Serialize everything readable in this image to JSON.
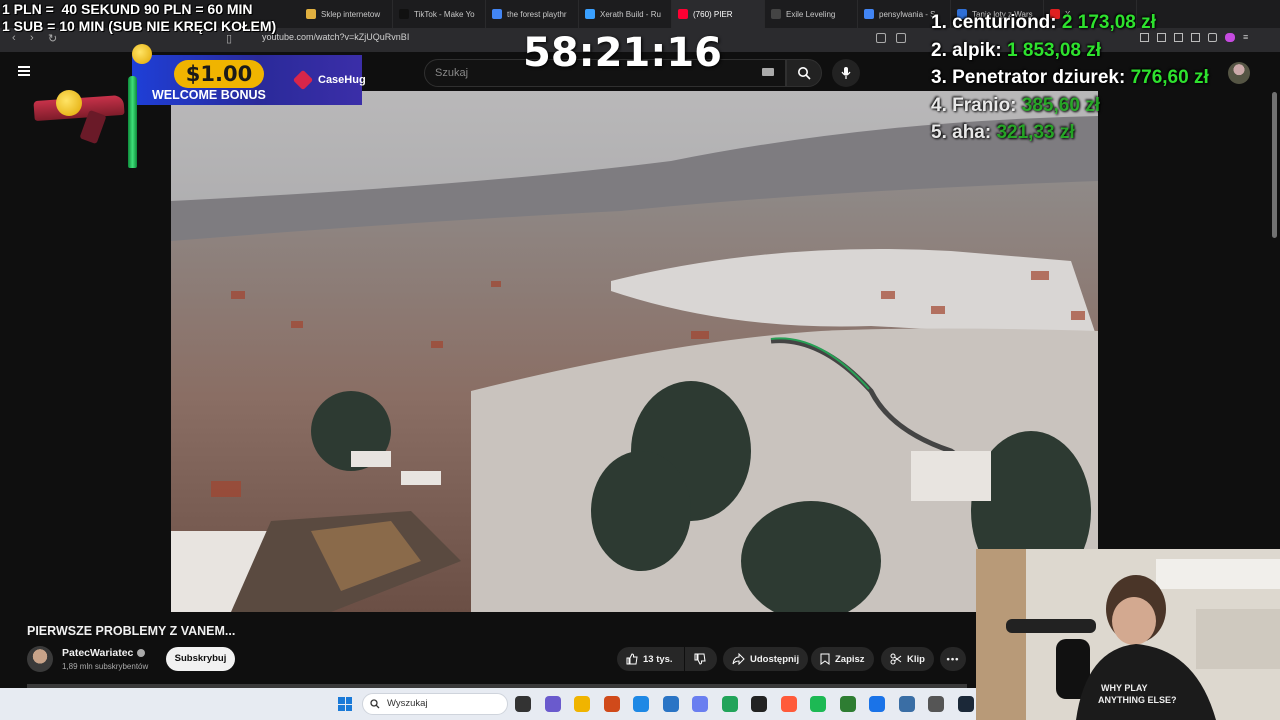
{
  "overlay": {
    "rules_line1": "1 PLN =  40 SEKUND 90 PLN = 60 MIN",
    "rules_line2": "1 SUB = 10 MIN (SUB NIE KRĘCI KOŁEM)",
    "timer": "58:21:16",
    "leaderboard": [
      {
        "label": "1. centuriond:",
        "amount": "2 173,08 zł"
      },
      {
        "label": "2. alpik:",
        "amount": "1 853,08 zł"
      },
      {
        "label": "3. Penetrator dziurek:",
        "amount": "776,60 zł"
      },
      {
        "label": "4. Franio:",
        "amount": "385,60 zł"
      },
      {
        "label": "5. aha:",
        "amount": "321,33 zł"
      }
    ],
    "bonus": {
      "amount": "$1.00",
      "text": "WELCOME BONUS",
      "brand": "CaseHug"
    }
  },
  "browser": {
    "tabs": [
      {
        "label": "Sklep internetow",
        "color": "#e0b040"
      },
      {
        "label": "TikTok - Make Yo",
        "color": "#111111"
      },
      {
        "label": "the forest playthr",
        "color": "#4285f4"
      },
      {
        "label": "Xerath Build - Ru",
        "color": "#3aa0ff"
      },
      {
        "label": "(760) PIER",
        "color": "#ff0033"
      },
      {
        "label": "Exile Leveling",
        "color": "#444444"
      },
      {
        "label": "pensylwania - S",
        "color": "#4285f4"
      },
      {
        "label": "Tanie loty z Wars",
        "color": "#2f6fd6"
      },
      {
        "label": "X",
        "color": "#e02020"
      }
    ],
    "url": "youtube.com/watch?v=kZjUQuRvnBI"
  },
  "youtube": {
    "search_placeholder": "Szukaj",
    "video_title": "PIERWSZE PROBLEMY Z VANEM...",
    "channel_name": "PatecWariatec",
    "channel_subs": "1,89 mln subskrybentów",
    "subscribe_label": "Subskrybuj",
    "likes": "13 tys.",
    "share_label": "Udostępnij",
    "save_label": "Zapisz",
    "clip_label": "Klip"
  },
  "taskbar": {
    "search_placeholder": "Wyszukaj"
  }
}
